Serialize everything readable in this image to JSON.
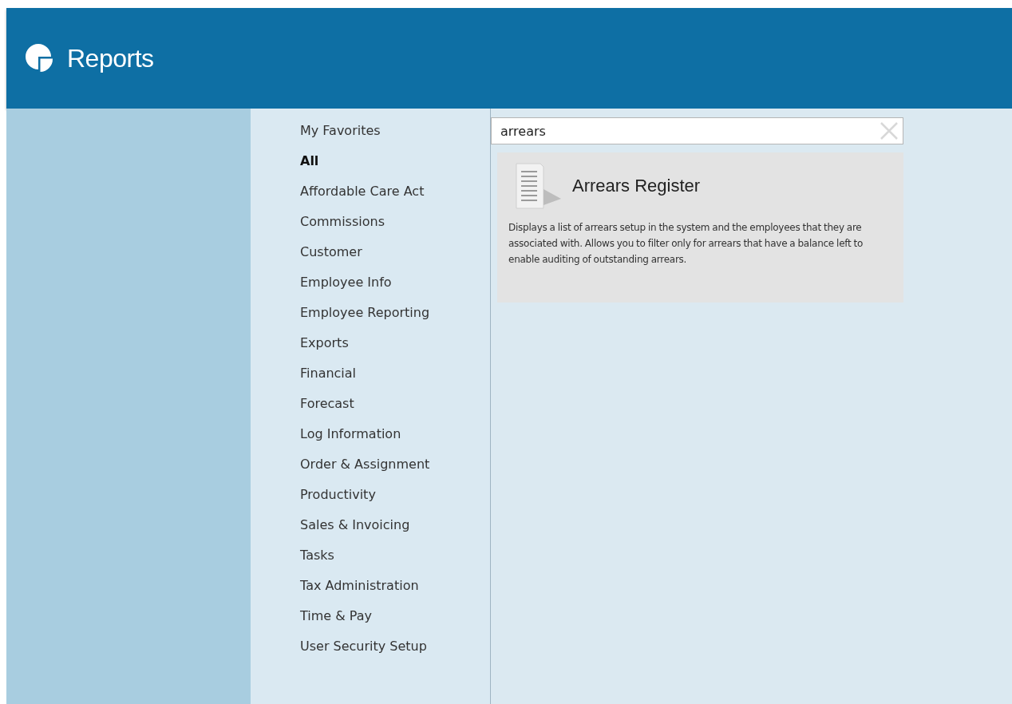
{
  "header": {
    "title": "Reports"
  },
  "categories": [
    {
      "label": "My Favorites",
      "selected": false
    },
    {
      "label": "All",
      "selected": true
    },
    {
      "label": "Affordable Care Act",
      "selected": false
    },
    {
      "label": "Commissions",
      "selected": false
    },
    {
      "label": "Customer",
      "selected": false
    },
    {
      "label": "Employee Info",
      "selected": false
    },
    {
      "label": "Employee Reporting",
      "selected": false
    },
    {
      "label": "Exports",
      "selected": false
    },
    {
      "label": "Financial",
      "selected": false
    },
    {
      "label": "Forecast",
      "selected": false
    },
    {
      "label": "Log Information",
      "selected": false
    },
    {
      "label": "Order & Assignment",
      "selected": false
    },
    {
      "label": "Productivity",
      "selected": false
    },
    {
      "label": "Sales & Invoicing",
      "selected": false
    },
    {
      "label": "Tasks",
      "selected": false
    },
    {
      "label": "Tax Administration",
      "selected": false
    },
    {
      "label": "Time & Pay",
      "selected": false
    },
    {
      "label": "User Security Setup",
      "selected": false
    }
  ],
  "search": {
    "value": "arrears"
  },
  "results": [
    {
      "title": "Arrears Register",
      "description": "Displays a list of arrears setup in the system and the employees that they are associated with.  Allows you to filter only for arrears that have a balance left to enable auditing of outstanding arrears."
    }
  ]
}
